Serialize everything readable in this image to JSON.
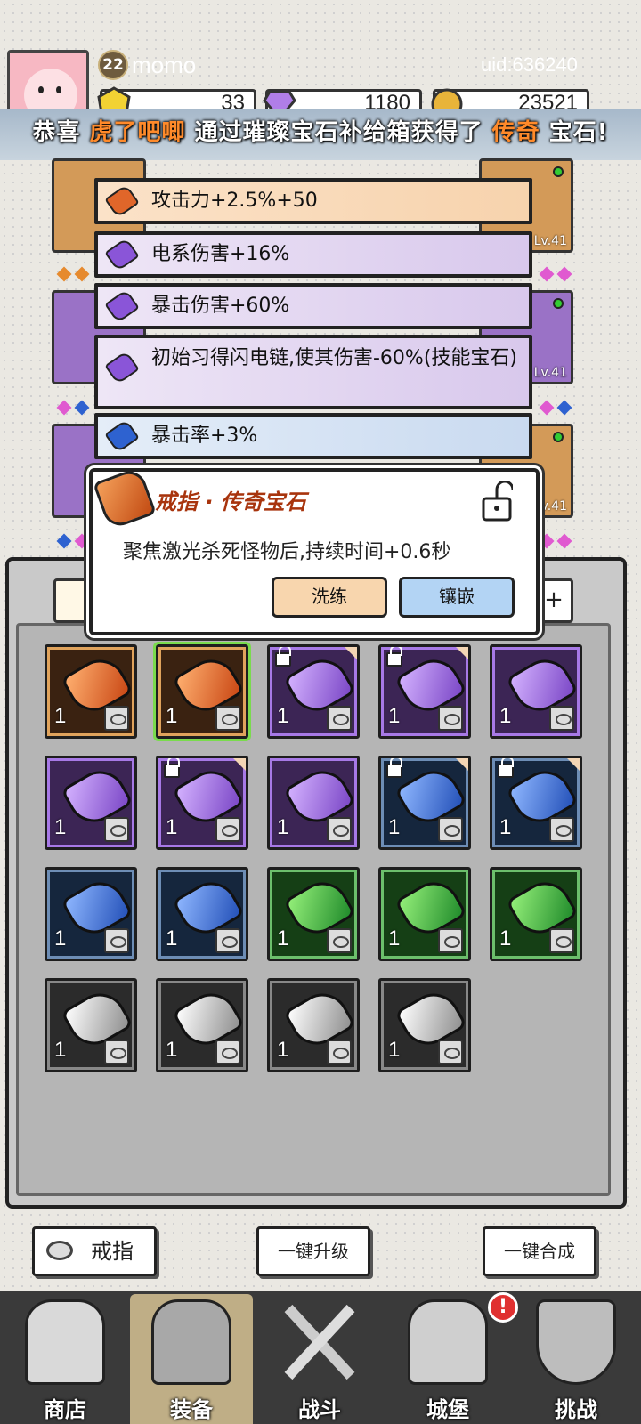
{
  "header": {
    "level": "22",
    "player_name": "momo",
    "uid": "uid:636240",
    "currencies": [
      {
        "name": "gold-gem",
        "value": "33"
      },
      {
        "name": "diamond",
        "value": "1180"
      },
      {
        "name": "coin",
        "value": "23521"
      }
    ]
  },
  "banner": {
    "prefix": "恭喜",
    "player": "虎了吧唧",
    "middle": "通过璀璨宝石补给箱获得了",
    "item": "传奇",
    "suffix": "宝石!"
  },
  "equip_levels": {
    "slot_right_1": "Lv.41",
    "slot_right_2": "Lv.41",
    "slot_right_3": "Lv.41"
  },
  "stats": [
    {
      "text": "攻击力+2.5%+50",
      "gem_color": "#e0662a"
    },
    {
      "text": "电系伤害+16%",
      "gem_color": "#8a55d8"
    },
    {
      "text": "暴击伤害+60%",
      "gem_color": "#8a55d8"
    },
    {
      "text": "初始习得闪电链,使其伤害-60%(技能宝石)",
      "gem_color": "#8a55d8"
    },
    {
      "text": "暴击率+3%",
      "gem_color": "#2e62d0"
    }
  ],
  "detail": {
    "title": "戒指 · 传奇宝石",
    "description": "聚焦激光杀死怪物后,持续时间+0.6秒",
    "reforge_label": "洗练",
    "inlay_label": "镶嵌"
  },
  "panel": {
    "plus_label": "+"
  },
  "inventory": [
    {
      "color": "orange",
      "count": "1",
      "locked": false
    },
    {
      "color": "orange",
      "count": "1",
      "locked": false,
      "selected": true
    },
    {
      "color": "purple",
      "count": "1",
      "locked": true
    },
    {
      "color": "purple",
      "count": "1",
      "locked": true
    },
    {
      "color": "purple",
      "count": "1",
      "locked": false
    },
    {
      "color": "purple",
      "count": "1",
      "locked": false
    },
    {
      "color": "purple",
      "count": "1",
      "locked": true
    },
    {
      "color": "purple",
      "count": "1",
      "locked": false
    },
    {
      "color": "blue",
      "count": "1",
      "locked": true
    },
    {
      "color": "blue",
      "count": "1",
      "locked": true
    },
    {
      "color": "blue",
      "count": "1",
      "locked": false
    },
    {
      "color": "blue",
      "count": "1",
      "locked": false
    },
    {
      "color": "green",
      "count": "1",
      "locked": false
    },
    {
      "color": "green",
      "count": "1",
      "locked": false
    },
    {
      "color": "green",
      "count": "1",
      "locked": false
    },
    {
      "color": "white",
      "count": "1",
      "locked": false
    },
    {
      "color": "white",
      "count": "1",
      "locked": false
    },
    {
      "color": "white",
      "count": "1",
      "locked": false
    },
    {
      "color": "white",
      "count": "1",
      "locked": false
    }
  ],
  "actions": {
    "ring_label": "戒指",
    "upgrade_label": "一键升级",
    "merge_label": "一键合成"
  },
  "nav": [
    {
      "label": "商店",
      "icon": "shop-icon"
    },
    {
      "label": "装备",
      "icon": "backpack-icon",
      "active": true
    },
    {
      "label": "战斗",
      "icon": "crossed-swords-icon"
    },
    {
      "label": "城堡",
      "icon": "castle-icon"
    },
    {
      "label": "挑战",
      "icon": "shield-icon"
    }
  ],
  "notification_badge": "!"
}
